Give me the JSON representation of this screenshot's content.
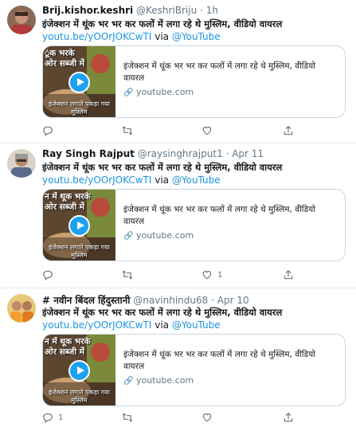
{
  "tweets": [
    {
      "name": "Brij.kishor.keshri",
      "handle": "@KeshriBriju",
      "dot": "·",
      "time": "1h",
      "text": "इंजेक्शन में थूंक भर भर कर फलों में लगा रहे थे मुस्लिम, वीडियो वायरल",
      "link": "youtu.be/yOOrJOKCwTI",
      "via": "via",
      "via_handle": "@YouTube",
      "card": {
        "thumb_top": "ूंक भरके\nओर सब्जी में",
        "thumb_bottom": "इंजेक्शन लगाते पकड़ा गया\nमुस्लिम",
        "title": "इंजेक्शन में थूंक भर भर कर फलों में लगा रहे थे मुस्लिम, वीडियो वायरल",
        "domain": "youtube.com"
      },
      "counts": {
        "reply": "",
        "retweet": "",
        "like": "",
        "share": ""
      }
    },
    {
      "name": "Ray Singh Rajput",
      "handle": "@raysinghrajput1",
      "dot": "·",
      "time": "Apr 11",
      "text": "इंजेक्शन में थूंक भर भर कर फलों में लगा रहे थे मुस्लिम, वीडियो वायरल",
      "link": "youtu.be/yOOrJOKCwTI",
      "via": "via",
      "via_handle": "@YouTube",
      "card": {
        "thumb_top": "न में थूक भरके\nओर सब्जी में",
        "thumb_bottom": "इंजेक्शन लगाते पकड़ा गया\nमुस्लिम",
        "title": "इंजेक्शन में थूंक भर भर कर फलों में लगा रहे थे मुस्लिम, वीडियो वायरल",
        "domain": "youtube.com"
      },
      "counts": {
        "reply": "",
        "retweet": "",
        "like": "1",
        "share": ""
      }
    },
    {
      "name": "# नवीन बिंदल हिंदुस्तानी",
      "handle": "@navinhindu68",
      "dot": "·",
      "time": "Apr 10",
      "text": "इंजेक्शन में थूंक भर भर कर फलों में लगा रहे थे मुस्लिम, वीडियो वायरल",
      "link": "youtu.be/yOOrJOKCwTI",
      "via": "via",
      "via_handle": "@YouTube",
      "card": {
        "thumb_top": "न में थूक भरके\nओर सब्जी में",
        "thumb_bottom": "इंजेक्शन लगाते पकड़ा गया\nमुस्लिम",
        "title": "इंजेक्शन में थूंक भर भर कर फलों में लगा रहे थे मुस्लिम, वीडियो वायरल",
        "domain": "youtube.com"
      },
      "counts": {
        "reply": "1",
        "retweet": "",
        "like": "",
        "share": ""
      }
    }
  ],
  "icons": {
    "reply": "reply-icon",
    "retweet": "retweet-icon",
    "like": "heart-icon",
    "share": "share-icon",
    "link": "link-icon",
    "play": "play-icon"
  },
  "colors": {
    "link": "#1b95e0",
    "muted": "#657786",
    "play": "#1da1f2",
    "border": "#ccd6dd"
  }
}
